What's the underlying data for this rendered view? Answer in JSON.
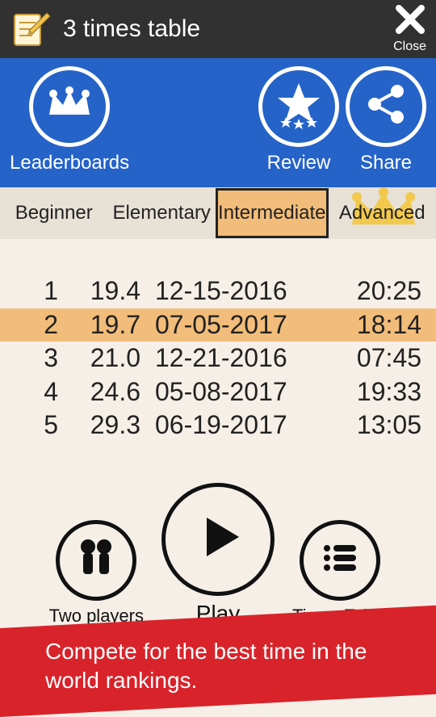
{
  "header": {
    "title": "3 times table",
    "close_label": "Close"
  },
  "toolbar": {
    "leaderboards_label": "Leaderboards",
    "review_label": "Review",
    "share_label": "Share"
  },
  "tabs": {
    "beginner": "Beginner",
    "elementary": "Elementary",
    "intermediate": "Intermediate",
    "advanced": "Advanced",
    "active": "intermediate"
  },
  "scores": [
    {
      "rank": "1",
      "score": "19.4",
      "date": "12-15-2016",
      "time": "20:25",
      "highlight": false
    },
    {
      "rank": "2",
      "score": "19.7",
      "date": "07-05-2017",
      "time": "18:14",
      "highlight": true
    },
    {
      "rank": "3",
      "score": "21.0",
      "date": "12-21-2016",
      "time": "07:45",
      "highlight": false
    },
    {
      "rank": "4",
      "score": "24.6",
      "date": "05-08-2017",
      "time": "19:33",
      "highlight": false
    },
    {
      "rank": "5",
      "score": "29.3",
      "date": "06-19-2017",
      "time": "13:05",
      "highlight": false
    }
  ],
  "controls": {
    "two_players_label": "Two players",
    "play_label": "Play",
    "times_table_label": "Times Table"
  },
  "banner": {
    "text": "Compete for the best time in the world rankings."
  },
  "colors": {
    "titlebar_bg": "#313131",
    "toolbar_bg": "#2563c8",
    "tab_active_bg": "#f2bd7a",
    "highlight_bg": "#f2bd7a",
    "banner_bg": "#d8232a"
  }
}
